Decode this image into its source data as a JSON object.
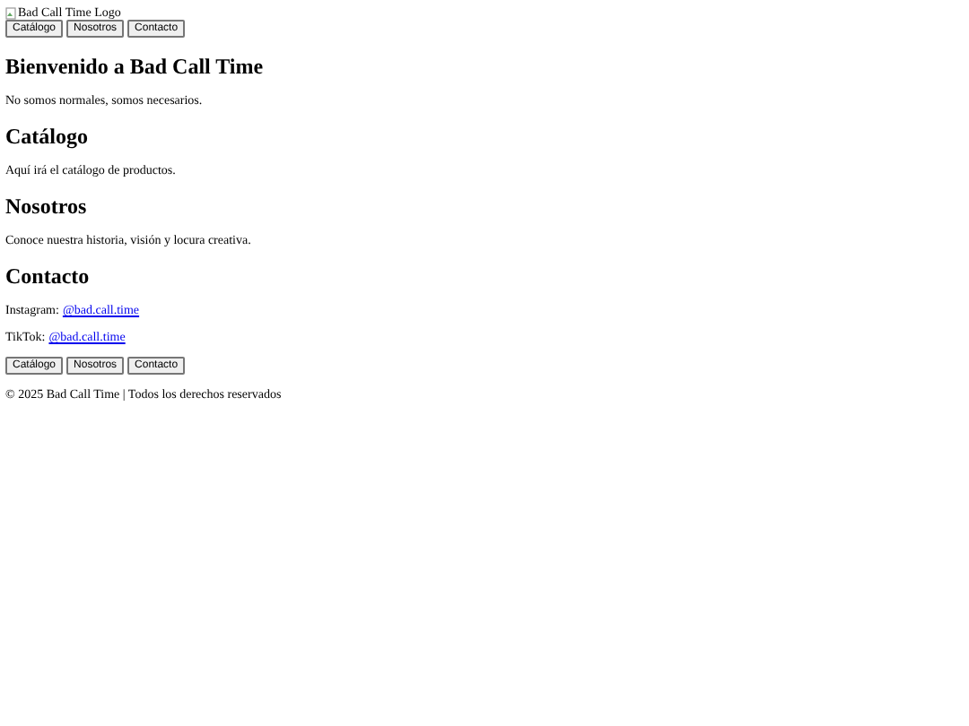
{
  "header": {
    "logo_alt": "Bad Call Time Logo",
    "nav": [
      "Catálogo",
      "Nosotros",
      "Contacto"
    ]
  },
  "sections": [
    {
      "title": "Bienvenido a Bad Call Time",
      "paragraphs": [
        {
          "text": "No somos normales, somos necesarios."
        }
      ]
    },
    {
      "title": "Catálogo",
      "paragraphs": [
        {
          "text": "Aquí irá el catálogo de productos."
        }
      ]
    },
    {
      "title": "Nosotros",
      "paragraphs": [
        {
          "text": "Conoce nuestra historia, visión y locura creativa."
        }
      ]
    },
    {
      "title": "Contacto",
      "paragraphs": [
        {
          "label": "Instagram:",
          "link": "@bad.call.time"
        },
        {
          "label": "TikTok:",
          "link": "@bad.call.time"
        }
      ]
    }
  ],
  "footer": {
    "nav": [
      "Catálogo",
      "Nosotros",
      "Contacto"
    ],
    "copyright": "© 2025 Bad Call Time | Todos los derechos reservados"
  }
}
